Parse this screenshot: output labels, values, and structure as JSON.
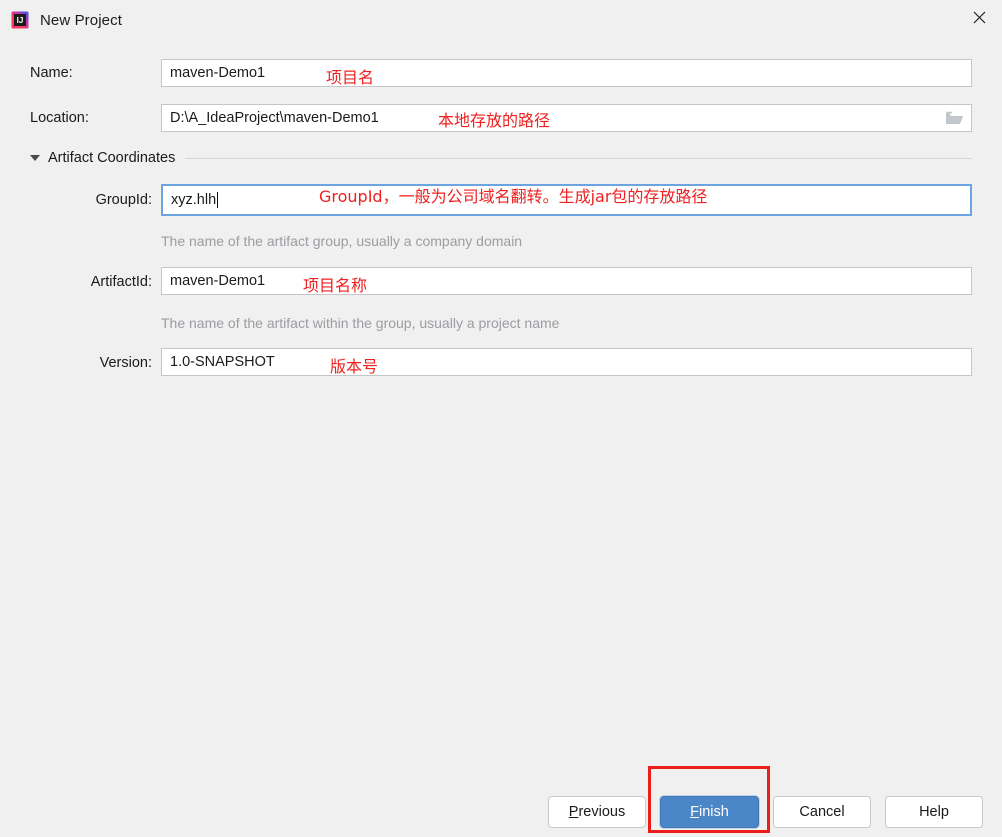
{
  "window": {
    "title": "New Project",
    "app_icon": "intellij-idea-icon",
    "close_icon": "close-icon"
  },
  "form": {
    "name": {
      "label": "Name:",
      "value": "maven-Demo1",
      "annotation": "项目名"
    },
    "location": {
      "label": "Location:",
      "value": "D:\\A_IdeaProject\\maven-Demo1",
      "annotation": "本地存放的路径",
      "browse_icon": "folder-icon"
    },
    "section": {
      "title": "Artifact Coordinates",
      "expanded": true,
      "toggle_icon": "triangle-down-icon"
    },
    "group_id": {
      "label": "GroupId:",
      "value": "xyz.hlh",
      "focused": true,
      "annotation": "GroupId，一般为公司域名翻转。生成jar包的存放路径",
      "hint": "The name of the artifact group, usually a company domain"
    },
    "artifact_id": {
      "label": "ArtifactId:",
      "value": "maven-Demo1",
      "annotation": "项目名称",
      "hint": "The name of the artifact within the group, usually a project name"
    },
    "version": {
      "label": "Version:",
      "value": "1.0-SNAPSHOT",
      "annotation": "版本号"
    }
  },
  "buttons": {
    "previous": {
      "mnemonic": "P",
      "rest": "revious"
    },
    "finish": {
      "mnemonic": "F",
      "rest": "inish"
    },
    "cancel": {
      "label": "Cancel"
    },
    "help": {
      "label": "Help"
    }
  },
  "colors": {
    "accent": "#4a86c8",
    "annotation": "#f02020",
    "highlight_box": "#ef1c1c",
    "background": "#f0f0f0",
    "hint_text": "#9a9da1",
    "focus_border": "#6ba4e0"
  }
}
